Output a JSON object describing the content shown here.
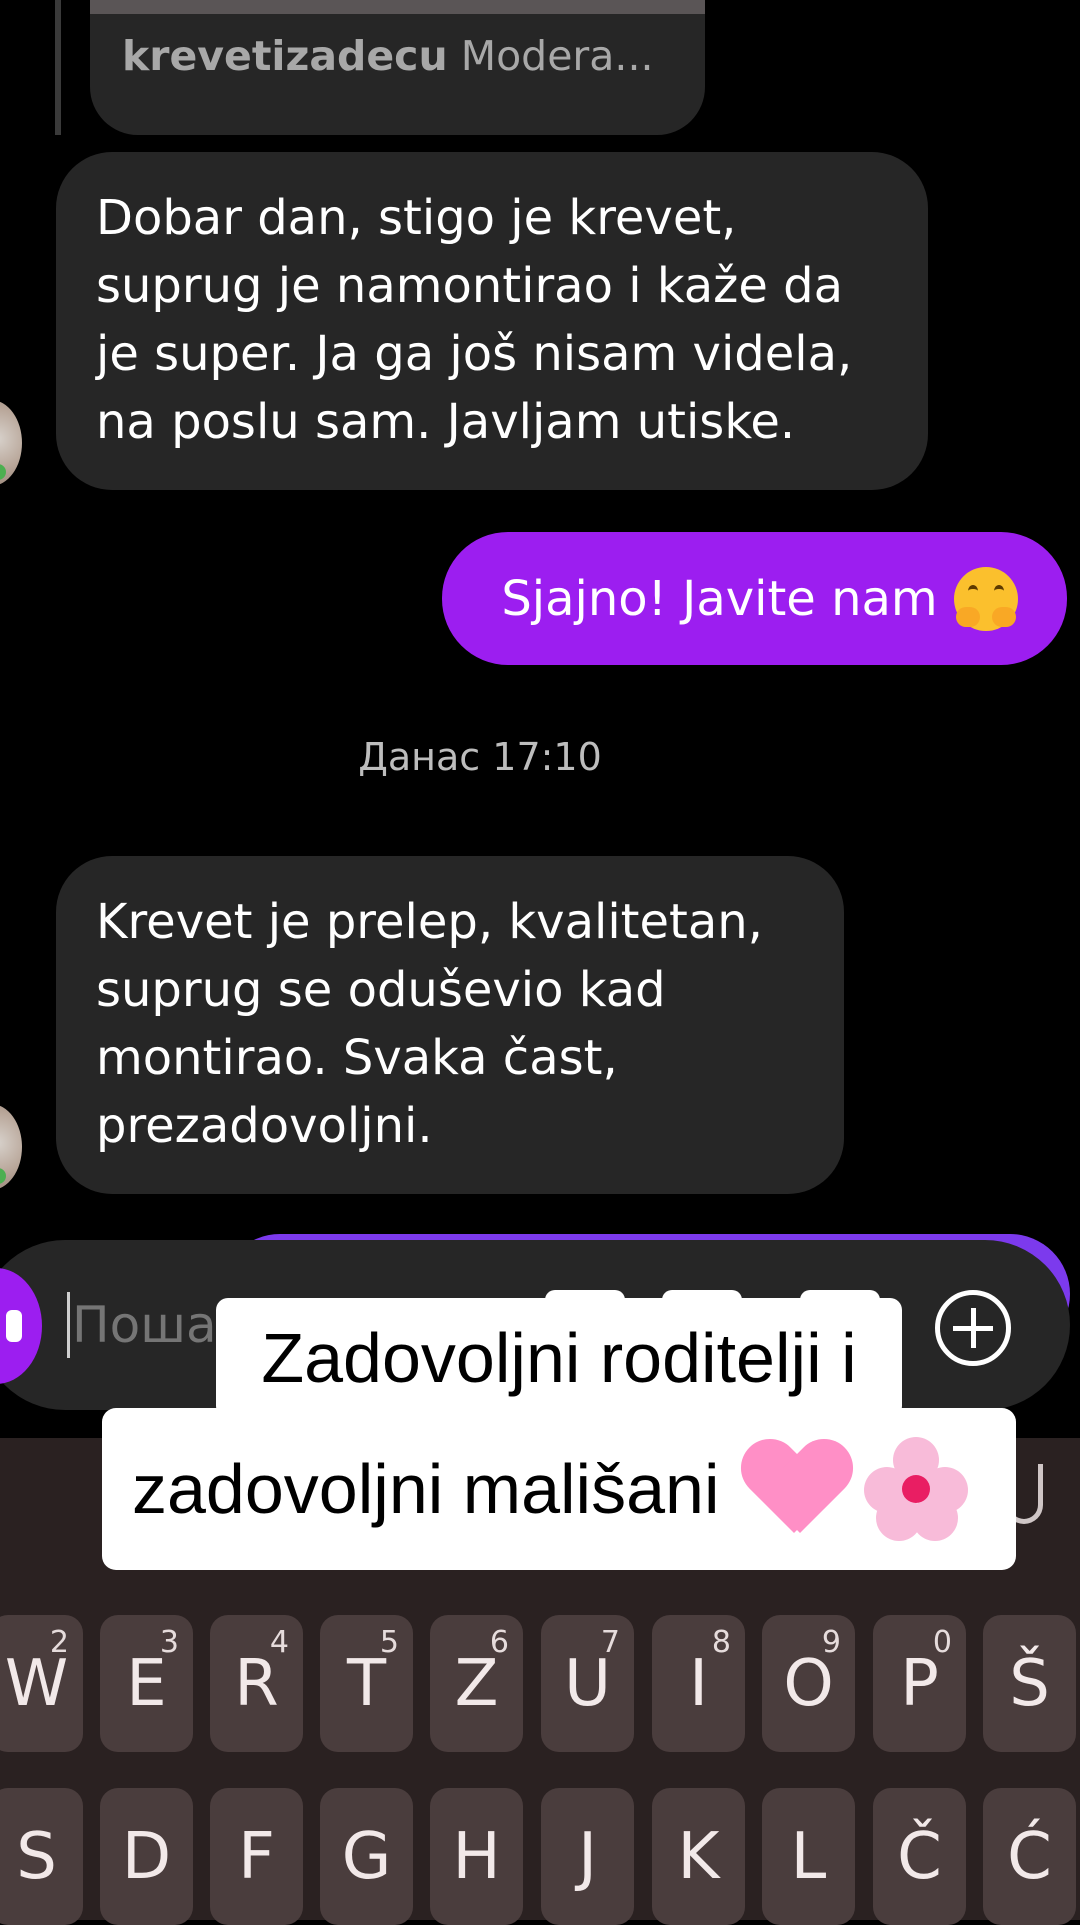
{
  "post": {
    "username": "krevetizadecu",
    "caption_rest": "Modera..."
  },
  "messages": {
    "first": {
      "lines": [
        "Dobar dan, stigo je krevet,",
        "suprug je namontirao i kaže da",
        "je super. Ja ga još nisam videla,",
        "na poslu sam. Javljam utiske."
      ]
    },
    "outgoing": {
      "text": "Sjajno! Javite nam",
      "emoji": "hugging-face"
    },
    "timestamp": "Данас 17:10",
    "second": {
      "lines": [
        "Krevet je prelep, kvalitetan,",
        "suprug se oduševio kad",
        "montirao. Svaka čast,",
        "prezadovoljni."
      ]
    }
  },
  "composer": {
    "placeholder": "Поша"
  },
  "caption": {
    "line1": "Zadovoljni roditelji i",
    "line2": "zadovoljni mališani",
    "emojis": [
      "pink-heart",
      "cherry-blossom"
    ]
  },
  "keyboard": {
    "row1": [
      {
        "key": "W",
        "hint": "2"
      },
      {
        "key": "E",
        "hint": "3"
      },
      {
        "key": "R",
        "hint": "4"
      },
      {
        "key": "T",
        "hint": "5"
      },
      {
        "key": "Z",
        "hint": "6"
      },
      {
        "key": "U",
        "hint": "7"
      },
      {
        "key": "I",
        "hint": "8"
      },
      {
        "key": "O",
        "hint": "9"
      },
      {
        "key": "P",
        "hint": "0"
      },
      {
        "key": "Š",
        "hint": ""
      }
    ],
    "row2": [
      {
        "key": "S"
      },
      {
        "key": "D"
      },
      {
        "key": "F"
      },
      {
        "key": "G"
      },
      {
        "key": "H"
      },
      {
        "key": "J"
      },
      {
        "key": "K"
      },
      {
        "key": "L"
      },
      {
        "key": "Č"
      },
      {
        "key": "Ć"
      }
    ]
  },
  "colors": {
    "outgoing": "#9c1ef0",
    "bubble": "#262626",
    "keyboard": "#2a2121",
    "key": "#4a3d3d"
  }
}
